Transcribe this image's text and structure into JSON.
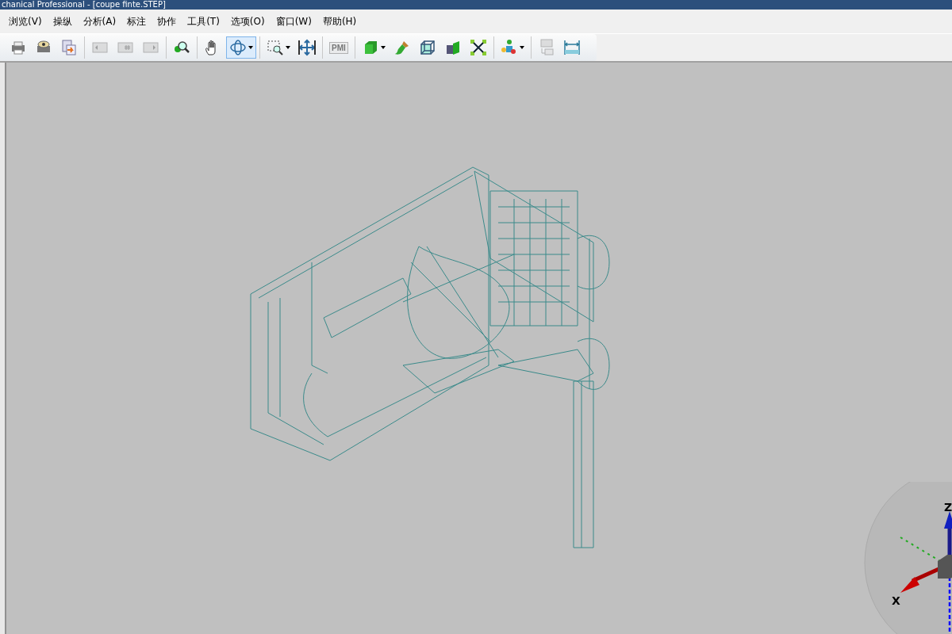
{
  "window": {
    "title": "chanical Professional - [coupe finte.STEP]"
  },
  "menu": [
    {
      "label": "浏览(V)"
    },
    {
      "label": "操纵"
    },
    {
      "label": "分析(A)"
    },
    {
      "label": "标注"
    },
    {
      "label": "协作"
    },
    {
      "label": "工具(T)"
    },
    {
      "label": "选项(O)"
    },
    {
      "label": "窗口(W)"
    },
    {
      "label": "帮助(H)"
    }
  ],
  "toolbar": [
    [
      {
        "kind": "print",
        "disabled": false,
        "selected": false
      },
      {
        "kind": "preview",
        "disabled": false,
        "selected": false
      },
      {
        "kind": "export",
        "disabled": false,
        "selected": false
      }
    ],
    [
      {
        "kind": "prev",
        "disabled": true,
        "selected": false
      },
      {
        "kind": "page",
        "disabled": true,
        "selected": false
      },
      {
        "kind": "next",
        "disabled": true,
        "selected": false
      }
    ],
    [
      {
        "kind": "find",
        "disabled": false,
        "selected": false
      }
    ],
    [
      {
        "kind": "pan",
        "disabled": false,
        "selected": false
      },
      {
        "kind": "rotate",
        "disabled": false,
        "selected": true,
        "dropdown": true
      }
    ],
    [
      {
        "kind": "zoombox",
        "disabled": false,
        "selected": false,
        "dropdown": true
      },
      {
        "kind": "fit",
        "disabled": false,
        "selected": false
      }
    ],
    [
      {
        "kind": "pmi",
        "disabled": true,
        "selected": false,
        "text": "PMI"
      }
    ],
    [
      {
        "kind": "solid",
        "disabled": false,
        "selected": false,
        "dropdown": true
      },
      {
        "kind": "brush",
        "disabled": false,
        "selected": false
      },
      {
        "kind": "wire",
        "disabled": false,
        "selected": false
      },
      {
        "kind": "section",
        "disabled": false,
        "selected": false
      },
      {
        "kind": "explode",
        "disabled": false,
        "selected": false
      }
    ],
    [
      {
        "kind": "assembly",
        "disabled": false,
        "selected": false,
        "dropdown": true
      }
    ],
    [
      {
        "kind": "convert",
        "disabled": true,
        "selected": false
      },
      {
        "kind": "measure",
        "disabled": false,
        "selected": false
      }
    ]
  ],
  "triad": {
    "z_label": "Z",
    "x_label": "X"
  }
}
